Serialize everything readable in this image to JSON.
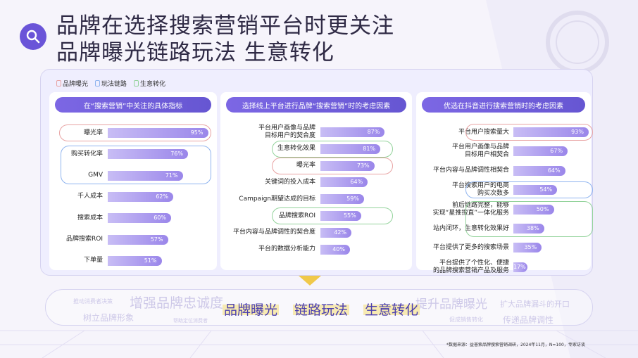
{
  "title": {
    "line1": "品牌在选择搜索营销平台时更关注",
    "line2": "品牌曝光链路玩法 生意转化"
  },
  "legend": [
    {
      "label": "品牌曝光",
      "color": "#e8a3a3"
    },
    {
      "label": "玩法链路",
      "color": "#8fb4ef"
    },
    {
      "label": "生意转化",
      "color": "#93d39b"
    }
  ],
  "colors": {
    "accent": "#6a54d8",
    "bar_start": "#c8bdf5",
    "bar_end": "#9a86ea"
  },
  "chart_data": [
    {
      "type": "bar",
      "title": "在“搜索营销”中关注的具体指标",
      "categories": [
        "曝光率",
        "购买转化率",
        "GMV",
        "千人成本",
        "搜索成本",
        "品牌搜索ROI",
        "下单量"
      ],
      "values": [
        95,
        76,
        71,
        62,
        60,
        57,
        51
      ],
      "value_labels": [
        "95%",
        "76%",
        "71%",
        "62%",
        "60%",
        "57%",
        "51%"
      ],
      "highlights": [
        {
          "type": "red",
          "from": 0,
          "to": 0
        },
        {
          "type": "blue",
          "from": 1,
          "to": 2
        }
      ]
    },
    {
      "type": "bar",
      "title": "选择线上平台进行品牌“搜索营销”时的考虑因素",
      "categories": [
        "平台用户画像与品牌\n目标用户的契合度",
        "生意转化效果",
        "曝光率",
        "关键词的投入成本",
        "Campaign期望达成的目标",
        "品牌搜索ROI",
        "平台内容与品牌调性的契合度",
        "平台的数据分析能力"
      ],
      "values": [
        87,
        81,
        73,
        64,
        59,
        55,
        42,
        40
      ],
      "value_labels": [
        "87%",
        "81%",
        "73%",
        "64%",
        "59%",
        "55%",
        "42%",
        "40%"
      ],
      "highlights": [
        {
          "type": "green",
          "from": 1,
          "to": 1
        },
        {
          "type": "red",
          "from": 2,
          "to": 2
        },
        {
          "type": "green",
          "from": 5,
          "to": 5
        }
      ]
    },
    {
      "type": "bar",
      "title": "优选在抖音进行搜索营销时的考虑因素",
      "categories": [
        "平台用户搜索量大",
        "平台用户画像与品牌\n目标用户相契合",
        "平台内容与品牌调性相契合",
        "平台搜索用户的电商\n购买次数多",
        "前后链路完整，能够\n实现“星推搜直”一体化服务",
        "站内闭环，生意转化效果好",
        "平台提供了更多的搜索场景",
        "平台提供了个性化、便捷\n的品牌搜索营销产品及服务"
      ],
      "values": [
        93,
        67,
        64,
        54,
        50,
        38,
        35,
        17
      ],
      "value_labels": [
        "93%",
        "67%",
        "64%",
        "54%",
        "50%",
        "38%",
        "35%",
        "17%"
      ],
      "highlights": [
        {
          "type": "red",
          "from": 0,
          "to": 0
        },
        {
          "type": "blue",
          "from": 3,
          "to": 3
        },
        {
          "type": "green",
          "from": 4,
          "to": 5
        }
      ]
    }
  ],
  "bottom": {
    "keywords": [
      "品牌曝光",
      "链路玩法",
      "生意转化"
    ],
    "faded": [
      "推动消费者决策",
      "增强品牌忠诚度",
      "树立品牌形象",
      "帮助定位消费者",
      "提升品牌曝光",
      "扩大品牌漏斗的开口",
      "促成销售转化",
      "传递品牌调性"
    ]
  },
  "source": "*数据来源：益普索品牌搜索营销调研，2024年11月，N=100，专家访谈"
}
